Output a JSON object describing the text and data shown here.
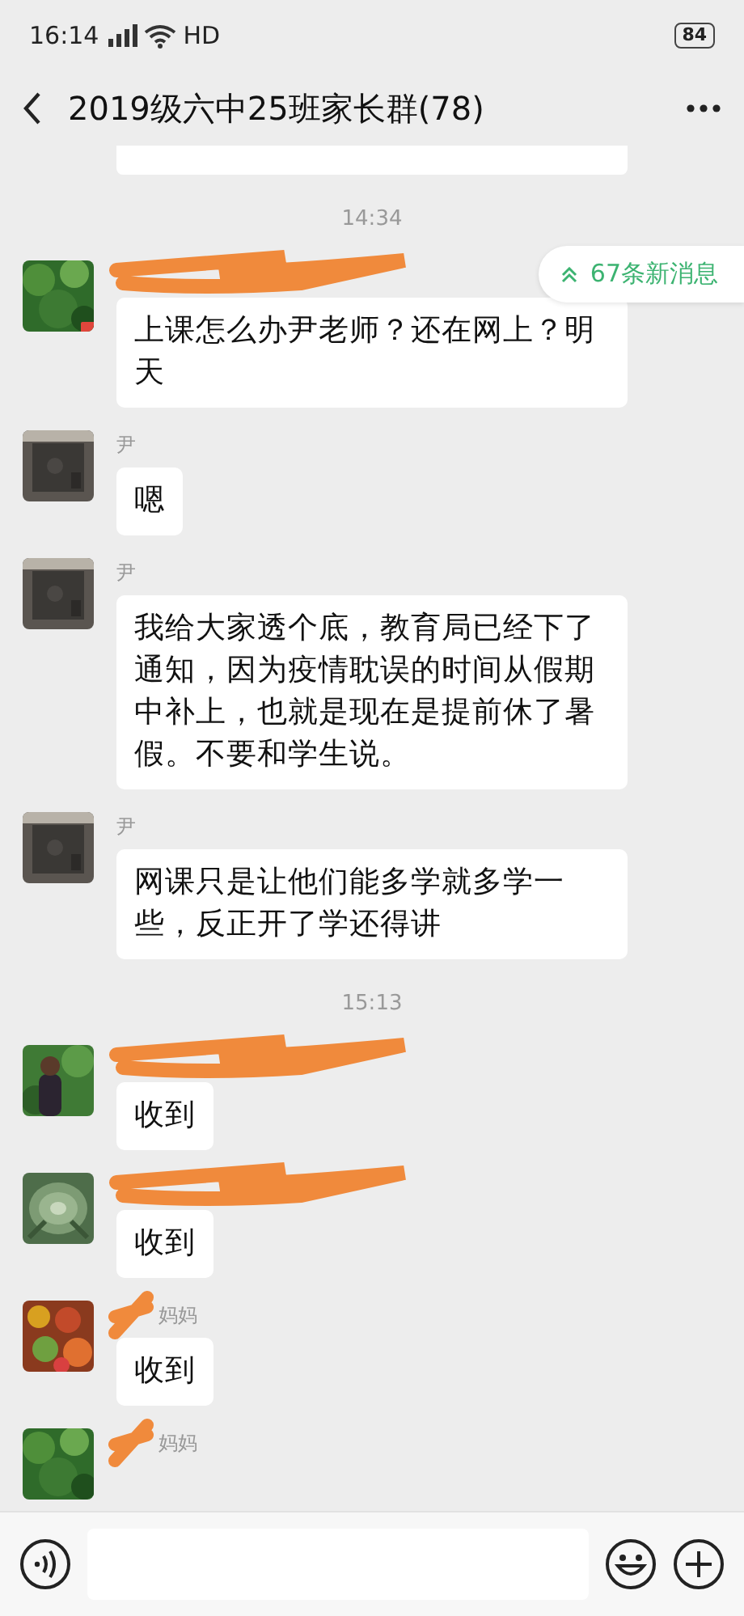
{
  "status_bar": {
    "time": "16:14",
    "network": "HD",
    "battery": "84"
  },
  "header": {
    "title": "2019级六中25班家长群(78)"
  },
  "new_messages": {
    "label": "67条新消息"
  },
  "chat": [
    {
      "kind": "partial"
    },
    {
      "kind": "time",
      "text": "14:34"
    },
    {
      "kind": "message",
      "name_redacted": true,
      "text": "上课怎么办尹老师？还在网上？明天",
      "badge": true
    },
    {
      "kind": "message",
      "name": "尹",
      "text": "嗯"
    },
    {
      "kind": "message",
      "name": "尹",
      "text": "我给大家透个底，教育局已经下了通知，因为疫情耽误的时间从假期中补上，也就是现在是提前休了暑假。不要和学生说。"
    },
    {
      "kind": "message",
      "name": "尹",
      "text": "网课只是让他们能多学就多学一些，反正开了学还得讲"
    },
    {
      "kind": "time",
      "text": "15:13"
    },
    {
      "kind": "message",
      "name_redacted": true,
      "text": "收到"
    },
    {
      "kind": "message",
      "name_redacted": true,
      "text": "收到"
    },
    {
      "kind": "message",
      "name": "妈妈",
      "name_redacted": true,
      "text": "收到"
    },
    {
      "kind": "message",
      "name": "妈妈",
      "name_redacted": true
    }
  ]
}
